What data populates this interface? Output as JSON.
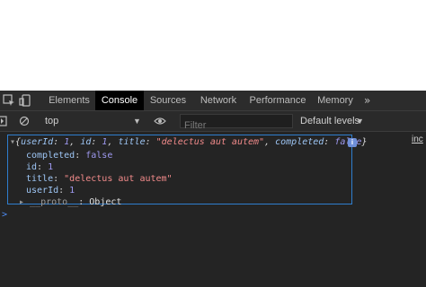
{
  "devtools": {
    "tabs": [
      {
        "label": "Elements",
        "active": false
      },
      {
        "label": "Console",
        "active": true
      },
      {
        "label": "Sources",
        "active": false
      },
      {
        "label": "Network",
        "active": false
      },
      {
        "label": "Performance",
        "active": false
      },
      {
        "label": "Memory",
        "active": false
      }
    ],
    "more_tabs_label": "»",
    "toolbar": {
      "context": "top",
      "filter_placeholder": "Filter",
      "levels_label": "Default levels",
      "levels_arrow": "▼",
      "context_arrow": "▼"
    },
    "console": {
      "summary": {
        "open": "{",
        "userId_key": "userId",
        "userId_val": "1",
        "id_key": "id",
        "id_val": "1",
        "title_key": "title",
        "title_val": "\"delectus aut autem\"",
        "completed_key": "completed",
        "completed_val": "false",
        "close": "}"
      },
      "info_badge": "i",
      "source_link": "inc",
      "properties": [
        {
          "key": "completed",
          "value": "false",
          "type": "keyword"
        },
        {
          "key": "id",
          "value": "1",
          "type": "number"
        },
        {
          "key": "title",
          "value": "\"delectus aut autem\"",
          "type": "string"
        },
        {
          "key": "userId",
          "value": "1",
          "type": "number"
        }
      ],
      "proto_key": "__proto__",
      "proto_val": "Object",
      "prompt_symbol": ">"
    },
    "colors": {
      "accent": "#2f7ecf",
      "string": "#f28b8b",
      "number": "#9e99f0",
      "background": "#242424"
    }
  }
}
